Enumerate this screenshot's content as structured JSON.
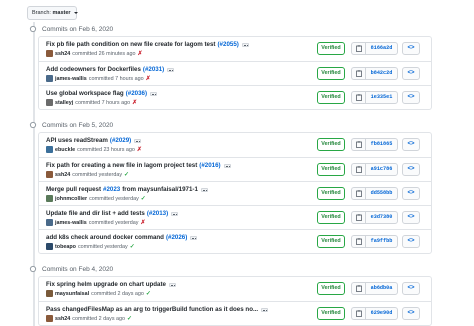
{
  "branch": {
    "label": "Branch:",
    "name": "master"
  },
  "days": [
    {
      "title": "Commits on Feb 6, 2020",
      "commits": [
        {
          "message": "Fix pb file path condition on new file create for lagom test",
          "pr": "(#2055)",
          "author": "ssh24",
          "time": "committed 26 minutes ago",
          "status": "fail",
          "verified": "Verified",
          "sha": "8166a2d",
          "avatar_color": "#8a5a3b"
        },
        {
          "message": "Add codeowners for Dockerfiles",
          "pr": "(#2031)",
          "author": "james-wallis",
          "time": "committed 7 hours ago",
          "status": "fail",
          "verified": "Verified",
          "sha": "b842c2d",
          "avatar_color": "#4a6a8a"
        },
        {
          "message": "Use global workspace flag",
          "pr": "(#2036)",
          "author": "stalleyj",
          "time": "committed 7 hours ago",
          "status": "fail",
          "verified": "Verified",
          "sha": "1e335e1",
          "avatar_color": "#6b6b6b"
        }
      ]
    },
    {
      "title": "Commits on Feb 5, 2020",
      "commits": [
        {
          "message": "API uses readStream",
          "pr": "(#2029)",
          "author": "ebuckle",
          "time": "committed 23 hours ago",
          "status": "fail",
          "verified": "Verified",
          "sha": "fb81865",
          "avatar_color": "#3b6f9a"
        },
        {
          "message": "Fix path for creating a new file in lagom project test",
          "pr": "(#2016)",
          "author": "ssh24",
          "time": "committed yesterday",
          "status": "ok",
          "verified": "Verified",
          "sha": "a91c786",
          "avatar_color": "#8a5a3b"
        },
        {
          "message": "Merge pull request",
          "pr": "#2023",
          "message_suffix": "from maysunfaisal/1971-1",
          "author": "johnmcollier",
          "time": "committed yesterday",
          "status": "ok",
          "verified": "Verified",
          "sha": "dd558bb",
          "avatar_color": "#5a7a5a"
        },
        {
          "message": "Update file and dir list + add tests",
          "pr": "(#2013)",
          "author": "james-wallis",
          "time": "committed yesterday",
          "status": "fail",
          "verified": "Verified",
          "sha": "e3d7380",
          "avatar_color": "#4a6a8a"
        },
        {
          "message": "add k8s check around docker command",
          "pr": "(#2026)",
          "author": "tobeapo",
          "time": "committed yesterday",
          "status": "ok",
          "verified": "Verified",
          "sha": "fa9ffbb",
          "avatar_color": "#2c4a6a"
        }
      ]
    },
    {
      "title": "Commits on Feb 4, 2020",
      "commits": [
        {
          "message": "Fix spring helm upgrade on chart update",
          "pr": "",
          "author": "maysunfaisal",
          "time": "committed 2 days ago",
          "status": "ok",
          "verified": "Verified",
          "sha": "ab6db0a",
          "avatar_color": "#7a5a3a"
        },
        {
          "message": "Pass changedFilesMap as an arg to triggerBuild function as it does no...",
          "pr": "",
          "author": "ssh24",
          "time": "committed 2 days ago",
          "status": "ok",
          "verified": "Verified",
          "sha": "629e90d",
          "avatar_color": "#8a5a3b"
        }
      ]
    }
  ],
  "icons": {
    "browse": "code-icon",
    "copy": "clipboard-icon",
    "commit": "commit-dot-icon"
  },
  "colors": {
    "link": "#0366d6",
    "verified": "#28a745",
    "fail": "#cb2431",
    "success": "#28a745"
  }
}
